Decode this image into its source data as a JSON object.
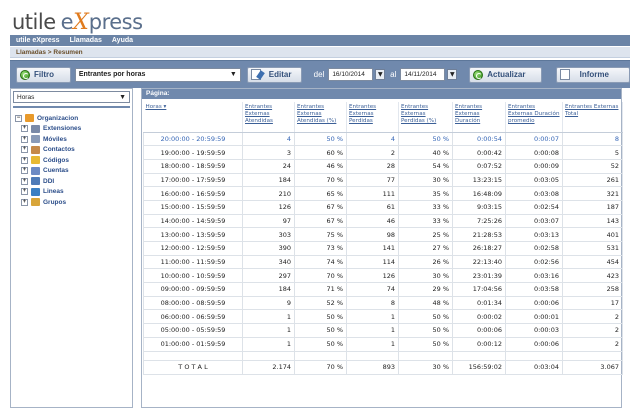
{
  "logo": {
    "part1": "utile",
    "part2": "e",
    "part3": "X",
    "part4": "press"
  },
  "menu": [
    "utile eXpress",
    "Llamadas",
    "Ayuda"
  ],
  "breadcrumb": "Llamadas > Resumen",
  "toolbar": {
    "filtro_label": "Filtro",
    "report_select": "Entrantes por horas",
    "editar_label": "Editar",
    "del_label": "del",
    "date_from": "16/10/2014",
    "al_label": "al",
    "date_to": "14/11/2014",
    "actualizar_label": "Actualizar",
    "informe_label": "Informe"
  },
  "left_panel": {
    "select_value": "Horas",
    "tree": [
      {
        "label": "Organizacion",
        "level": 0,
        "expander": "⊟",
        "icon_color": "#e89a2c"
      },
      {
        "label": "Extensiones",
        "level": 1,
        "expander": "⊞",
        "icon_color": "#7a8aa8"
      },
      {
        "label": "Móviles",
        "level": 1,
        "expander": "⊞",
        "icon_color": "#8a9bb8"
      },
      {
        "label": "Contactos",
        "level": 1,
        "expander": "⊞",
        "icon_color": "#c58a4a"
      },
      {
        "label": "Códigos",
        "level": 1,
        "expander": "⊞",
        "icon_color": "#e7b934"
      },
      {
        "label": "Cuentas",
        "level": 1,
        "expander": "⊞",
        "icon_color": "#6c8ac4"
      },
      {
        "label": "DDI",
        "level": 1,
        "expander": "⊞",
        "icon_color": "#4e7bb8"
      },
      {
        "label": "Lineas",
        "level": 1,
        "expander": "⊞",
        "icon_color": "#3a7fc4"
      },
      {
        "label": "Grupos",
        "level": 1,
        "expander": "⊞",
        "icon_color": "#d8a53a"
      }
    ]
  },
  "table": {
    "pagina_label": "Página:",
    "headers": [
      "Horas ▾",
      "Entrantes Externas Atendidas",
      "Entrantes Externas Atendidas (%)",
      "Entrantes Externas Perdidas",
      "Entrantes Externas Perdidas (%)",
      "Entrantes Externas Duración",
      "Entrantes Externas Duración promedio",
      "Entrantes Externas Total"
    ],
    "rows": [
      [
        "20:00:00 - 20:59:59",
        "4",
        "50 %",
        "4",
        "50 %",
        "0:00:54",
        "0:00:07",
        "8"
      ],
      [
        "19:00:00 - 19:59:59",
        "3",
        "60 %",
        "2",
        "40 %",
        "0:00:42",
        "0:00:08",
        "5"
      ],
      [
        "18:00:00 - 18:59:59",
        "24",
        "46 %",
        "28",
        "54 %",
        "0:07:52",
        "0:00:09",
        "52"
      ],
      [
        "17:00:00 - 17:59:59",
        "184",
        "70 %",
        "77",
        "30 %",
        "13:23:15",
        "0:03:05",
        "261"
      ],
      [
        "16:00:00 - 16:59:59",
        "210",
        "65 %",
        "111",
        "35 %",
        "16:48:09",
        "0:03:08",
        "321"
      ],
      [
        "15:00:00 - 15:59:59",
        "126",
        "67 %",
        "61",
        "33 %",
        "9:03:15",
        "0:02:54",
        "187"
      ],
      [
        "14:00:00 - 14:59:59",
        "97",
        "67 %",
        "46",
        "33 %",
        "7:25:26",
        "0:03:07",
        "143"
      ],
      [
        "13:00:00 - 13:59:59",
        "303",
        "75 %",
        "98",
        "25 %",
        "21:28:53",
        "0:03:13",
        "401"
      ],
      [
        "12:00:00 - 12:59:59",
        "390",
        "73 %",
        "141",
        "27 %",
        "26:18:27",
        "0:02:58",
        "531"
      ],
      [
        "11:00:00 - 11:59:59",
        "340",
        "74 %",
        "114",
        "26 %",
        "22:13:40",
        "0:02:56",
        "454"
      ],
      [
        "10:00:00 - 10:59:59",
        "297",
        "70 %",
        "126",
        "30 %",
        "23:01:39",
        "0:03:16",
        "423"
      ],
      [
        "09:00:00 - 09:59:59",
        "184",
        "71 %",
        "74",
        "29 %",
        "17:04:56",
        "0:03:58",
        "258"
      ],
      [
        "08:00:00 - 08:59:59",
        "9",
        "52 %",
        "8",
        "48 %",
        "0:01:34",
        "0:00:06",
        "17"
      ],
      [
        "06:00:00 - 06:59:59",
        "1",
        "50 %",
        "1",
        "50 %",
        "0:00:02",
        "0:00:01",
        "2"
      ],
      [
        "05:00:00 - 05:59:59",
        "1",
        "50 %",
        "1",
        "50 %",
        "0:00:06",
        "0:00:03",
        "2"
      ],
      [
        "01:00:00 - 01:59:59",
        "1",
        "50 %",
        "1",
        "50 %",
        "0:00:12",
        "0:00:06",
        "2"
      ]
    ],
    "total_row": [
      "T O T A L",
      "2.174",
      "70 %",
      "893",
      "30 %",
      "156:59:02",
      "0:03:04",
      "3.067"
    ]
  }
}
